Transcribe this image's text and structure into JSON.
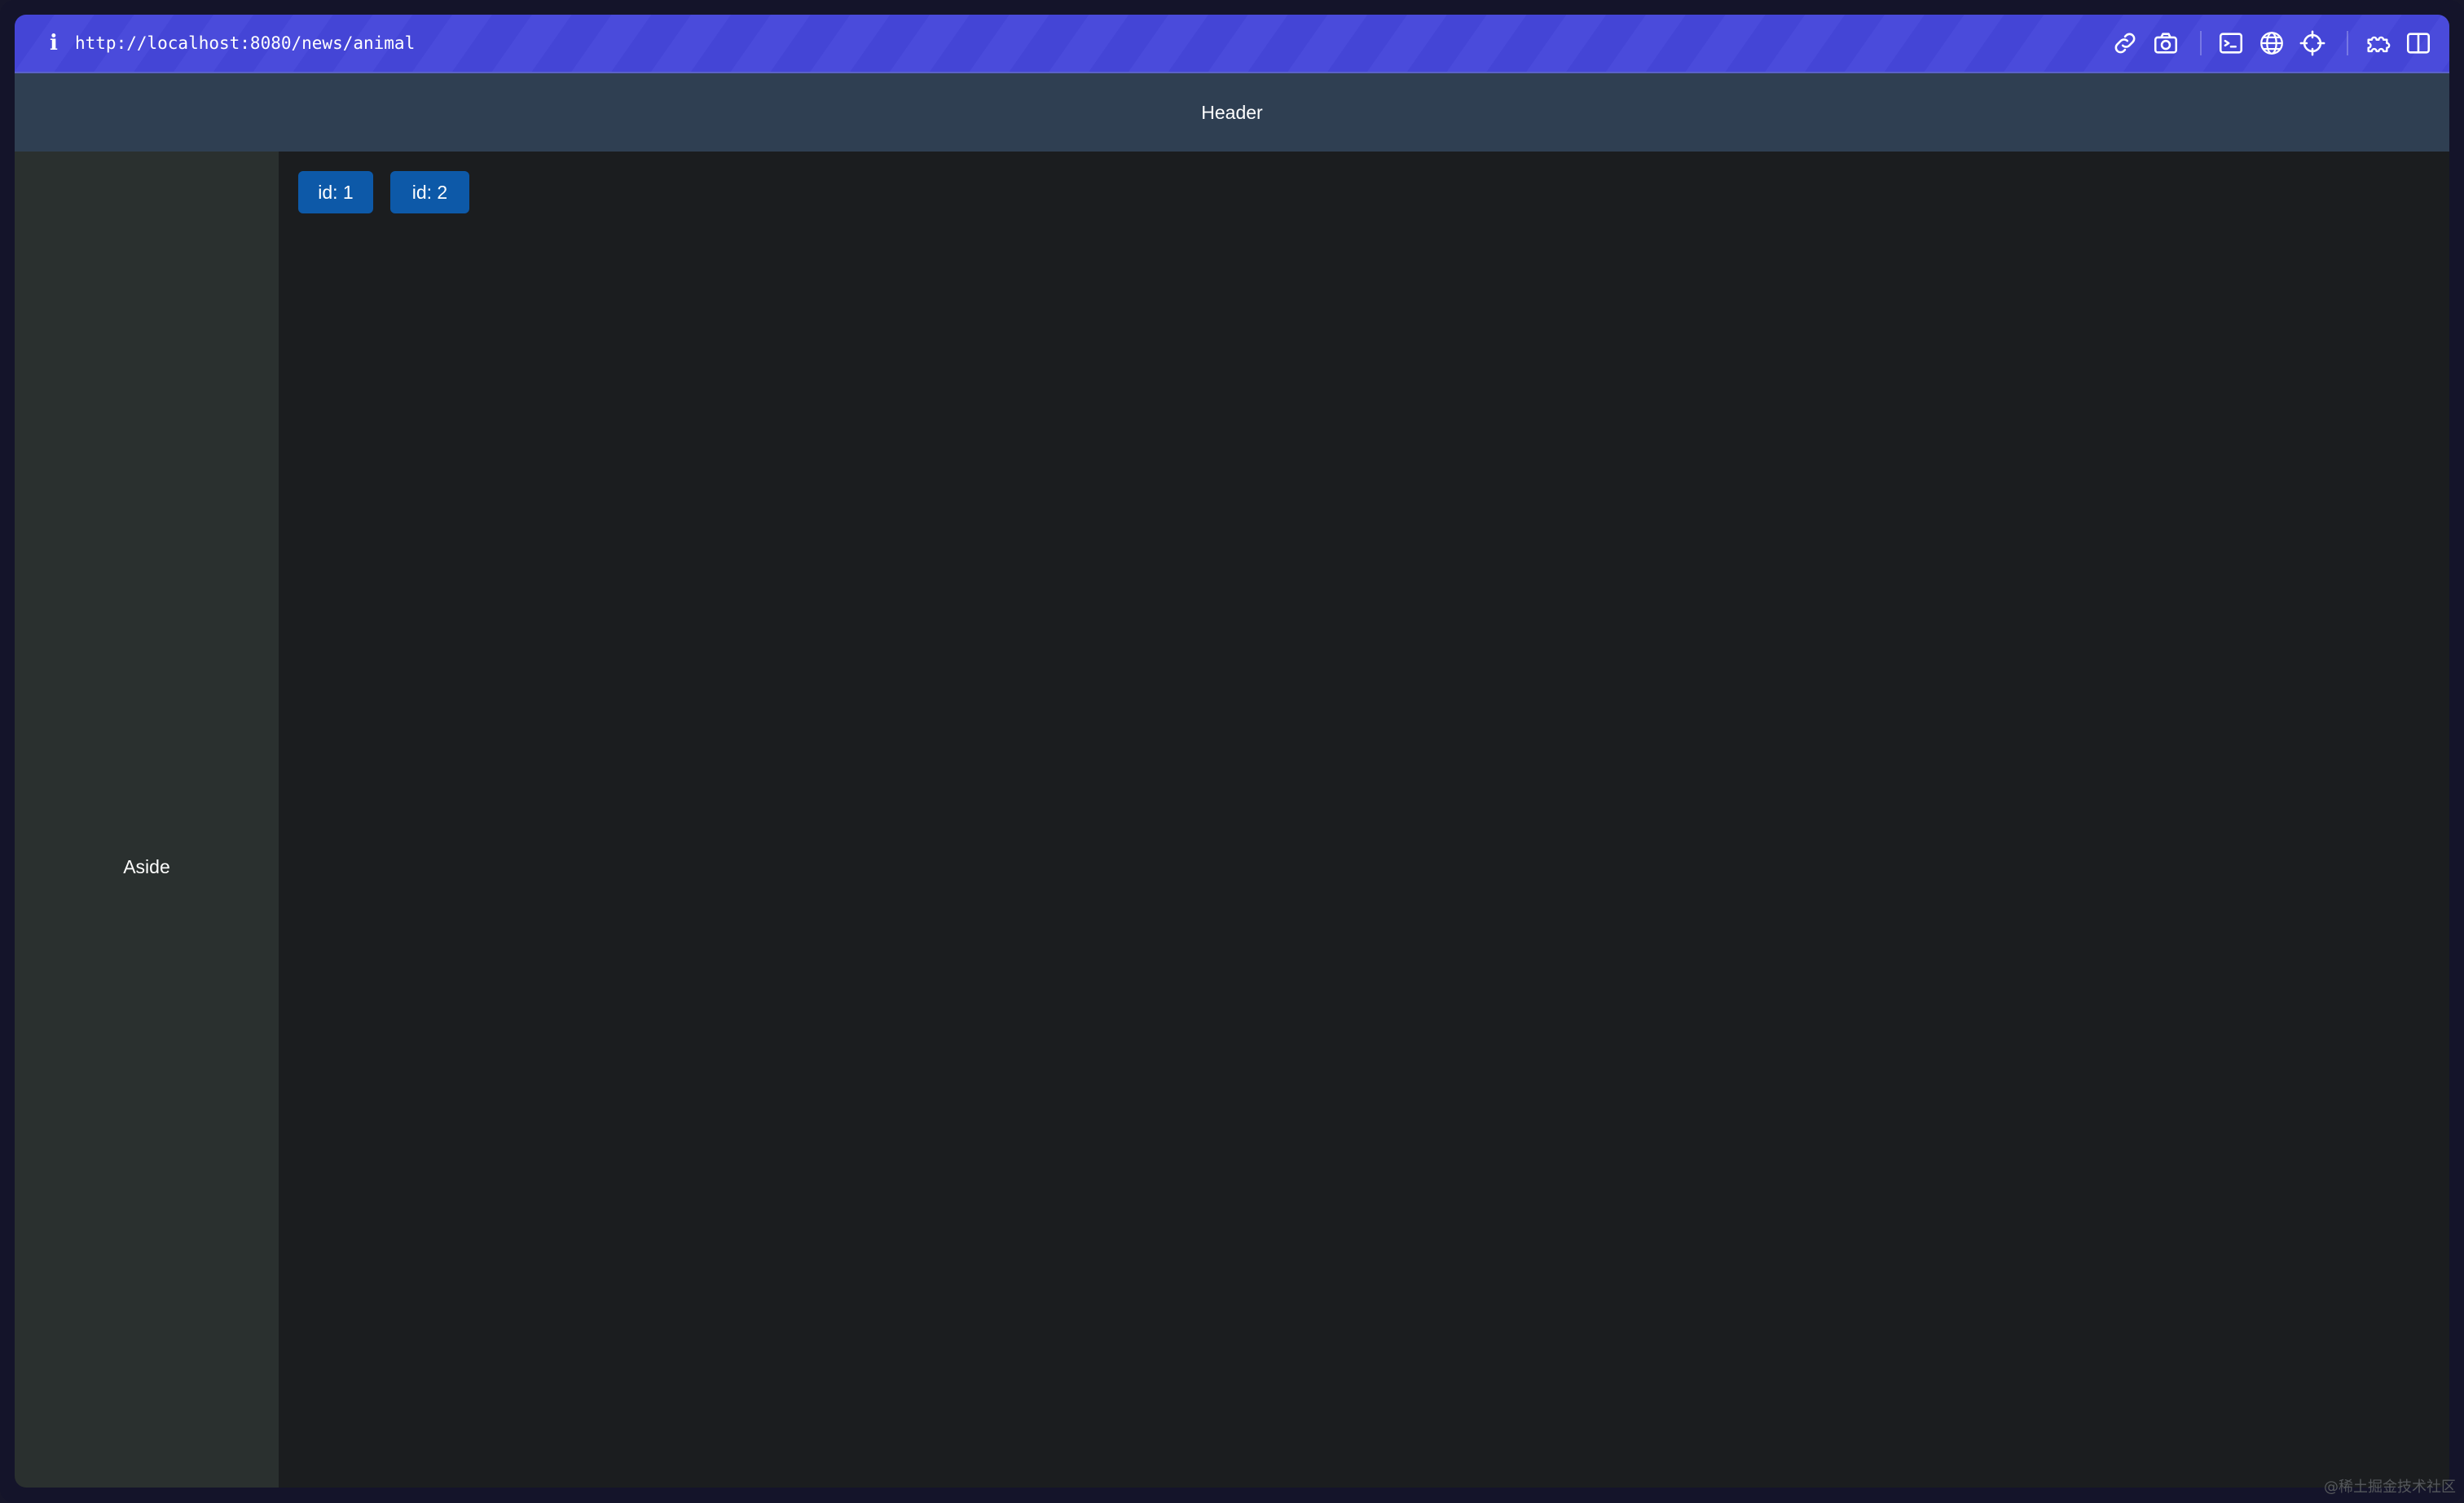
{
  "browser": {
    "url": "http://localhost:8080/news/animal",
    "info_icon": "info-icon",
    "tool_icons": [
      "link-icon",
      "camera-icon",
      "terminal-icon",
      "globe-icon",
      "crosshair-icon",
      "extension-icon",
      "split-view-icon"
    ],
    "accent_color": "#4445d6"
  },
  "header": {
    "title": "Header"
  },
  "aside": {
    "label": "Aside"
  },
  "main": {
    "buttons": [
      {
        "label": "id: 1"
      },
      {
        "label": "id: 2"
      }
    ],
    "button_color": "#0d59a8"
  },
  "watermark": "@稀土掘金技术社区"
}
